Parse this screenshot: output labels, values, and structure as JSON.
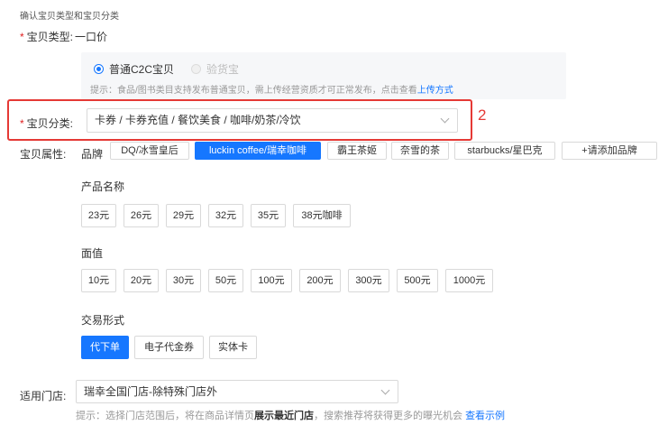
{
  "section_title": "确认宝贝类型和宝贝分类",
  "item_type": {
    "label": "宝贝类型:",
    "value": "一口价",
    "options": [
      {
        "label": "普通C2C宝贝",
        "selected": true
      },
      {
        "label": "验货宝",
        "selected": false,
        "disabled": true
      }
    ],
    "hint_text": "提示：食品/图书类目支持发布普通宝贝，需上传经营资质才可正常发布，点击查看",
    "hint_link": "上传方式"
  },
  "category": {
    "label": "宝贝分类:",
    "value": "卡券 / 卡券充值 / 餐饮美食 / 咖啡/奶茶/冷饮"
  },
  "annotation": {
    "step_number": "2",
    "color": "#e53935"
  },
  "attributes": {
    "label": "宝贝属性:",
    "brand": {
      "label": "品牌",
      "tags": [
        "DQ/冰雪皇后",
        "luckin coffee/瑞幸咖啡",
        "霸王茶姬",
        "奈雪的茶",
        "starbucks/星巴克",
        "+请添加品牌"
      ],
      "selected": "luckin coffee/瑞幸咖啡"
    },
    "product_name": {
      "label": "产品名称",
      "options": [
        "23元",
        "26元",
        "29元",
        "32元",
        "35元",
        "38元咖啡"
      ]
    },
    "face_value": {
      "label": "面值",
      "options": [
        "10元",
        "20元",
        "30元",
        "50元",
        "100元",
        "200元",
        "300元",
        "500元",
        "1000元"
      ]
    },
    "trade_form": {
      "label": "交易形式",
      "options": [
        "代下单",
        "电子代金券",
        "实体卡"
      ],
      "selected": "代下单"
    }
  },
  "store": {
    "label": "适用门店:",
    "value": "瑞幸全国门店-除特殊门店外",
    "hint_prefix": "提示：选择门店范围后，将在商品详情页",
    "hint_bold": "展示最近门店",
    "hint_suffix": "，搜索推荐将获得更多的曝光机会",
    "hint_link": "查看示例"
  },
  "colors": {
    "accent": "#1677ff",
    "required": "#e02020"
  }
}
